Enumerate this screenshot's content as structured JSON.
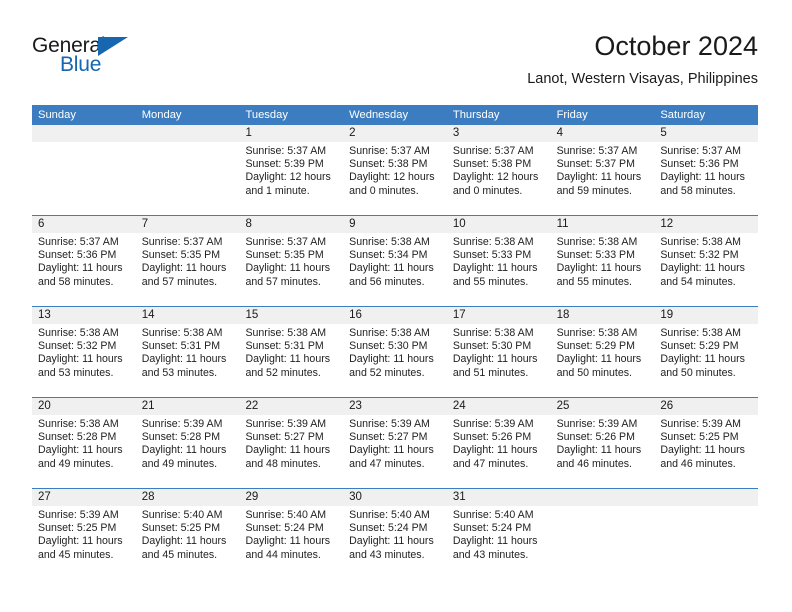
{
  "brand": {
    "name_part1": "General",
    "name_part2": "Blue",
    "triangle_icon": "triangle-icon",
    "accent_color": "#1666b0"
  },
  "header": {
    "title": "October 2024",
    "subtitle": "Lanot, Western Visayas, Philippines"
  },
  "colors": {
    "header_blue": "#3b7dc0",
    "date_band": "#f0f0f0",
    "text": "#1a1a1a"
  },
  "weekdays": [
    "Sunday",
    "Monday",
    "Tuesday",
    "Wednesday",
    "Thursday",
    "Friday",
    "Saturday"
  ],
  "weeks": [
    {
      "days": [
        {
          "num": "",
          "lines": []
        },
        {
          "num": "",
          "lines": []
        },
        {
          "num": "1",
          "lines": [
            "Sunrise: 5:37 AM",
            "Sunset: 5:39 PM",
            "Daylight: 12 hours",
            "and 1 minute."
          ]
        },
        {
          "num": "2",
          "lines": [
            "Sunrise: 5:37 AM",
            "Sunset: 5:38 PM",
            "Daylight: 12 hours",
            "and 0 minutes."
          ]
        },
        {
          "num": "3",
          "lines": [
            "Sunrise: 5:37 AM",
            "Sunset: 5:38 PM",
            "Daylight: 12 hours",
            "and 0 minutes."
          ]
        },
        {
          "num": "4",
          "lines": [
            "Sunrise: 5:37 AM",
            "Sunset: 5:37 PM",
            "Daylight: 11 hours",
            "and 59 minutes."
          ]
        },
        {
          "num": "5",
          "lines": [
            "Sunrise: 5:37 AM",
            "Sunset: 5:36 PM",
            "Daylight: 11 hours",
            "and 58 minutes."
          ]
        }
      ]
    },
    {
      "days": [
        {
          "num": "6",
          "lines": [
            "Sunrise: 5:37 AM",
            "Sunset: 5:36 PM",
            "Daylight: 11 hours",
            "and 58 minutes."
          ]
        },
        {
          "num": "7",
          "lines": [
            "Sunrise: 5:37 AM",
            "Sunset: 5:35 PM",
            "Daylight: 11 hours",
            "and 57 minutes."
          ]
        },
        {
          "num": "8",
          "lines": [
            "Sunrise: 5:37 AM",
            "Sunset: 5:35 PM",
            "Daylight: 11 hours",
            "and 57 minutes."
          ]
        },
        {
          "num": "9",
          "lines": [
            "Sunrise: 5:38 AM",
            "Sunset: 5:34 PM",
            "Daylight: 11 hours",
            "and 56 minutes."
          ]
        },
        {
          "num": "10",
          "lines": [
            "Sunrise: 5:38 AM",
            "Sunset: 5:33 PM",
            "Daylight: 11 hours",
            "and 55 minutes."
          ]
        },
        {
          "num": "11",
          "lines": [
            "Sunrise: 5:38 AM",
            "Sunset: 5:33 PM",
            "Daylight: 11 hours",
            "and 55 minutes."
          ]
        },
        {
          "num": "12",
          "lines": [
            "Sunrise: 5:38 AM",
            "Sunset: 5:32 PM",
            "Daylight: 11 hours",
            "and 54 minutes."
          ]
        }
      ]
    },
    {
      "days": [
        {
          "num": "13",
          "lines": [
            "Sunrise: 5:38 AM",
            "Sunset: 5:32 PM",
            "Daylight: 11 hours",
            "and 53 minutes."
          ]
        },
        {
          "num": "14",
          "lines": [
            "Sunrise: 5:38 AM",
            "Sunset: 5:31 PM",
            "Daylight: 11 hours",
            "and 53 minutes."
          ]
        },
        {
          "num": "15",
          "lines": [
            "Sunrise: 5:38 AM",
            "Sunset: 5:31 PM",
            "Daylight: 11 hours",
            "and 52 minutes."
          ]
        },
        {
          "num": "16",
          "lines": [
            "Sunrise: 5:38 AM",
            "Sunset: 5:30 PM",
            "Daylight: 11 hours",
            "and 52 minutes."
          ]
        },
        {
          "num": "17",
          "lines": [
            "Sunrise: 5:38 AM",
            "Sunset: 5:30 PM",
            "Daylight: 11 hours",
            "and 51 minutes."
          ]
        },
        {
          "num": "18",
          "lines": [
            "Sunrise: 5:38 AM",
            "Sunset: 5:29 PM",
            "Daylight: 11 hours",
            "and 50 minutes."
          ]
        },
        {
          "num": "19",
          "lines": [
            "Sunrise: 5:38 AM",
            "Sunset: 5:29 PM",
            "Daylight: 11 hours",
            "and 50 minutes."
          ]
        }
      ]
    },
    {
      "days": [
        {
          "num": "20",
          "lines": [
            "Sunrise: 5:38 AM",
            "Sunset: 5:28 PM",
            "Daylight: 11 hours",
            "and 49 minutes."
          ]
        },
        {
          "num": "21",
          "lines": [
            "Sunrise: 5:39 AM",
            "Sunset: 5:28 PM",
            "Daylight: 11 hours",
            "and 49 minutes."
          ]
        },
        {
          "num": "22",
          "lines": [
            "Sunrise: 5:39 AM",
            "Sunset: 5:27 PM",
            "Daylight: 11 hours",
            "and 48 minutes."
          ]
        },
        {
          "num": "23",
          "lines": [
            "Sunrise: 5:39 AM",
            "Sunset: 5:27 PM",
            "Daylight: 11 hours",
            "and 47 minutes."
          ]
        },
        {
          "num": "24",
          "lines": [
            "Sunrise: 5:39 AM",
            "Sunset: 5:26 PM",
            "Daylight: 11 hours",
            "and 47 minutes."
          ]
        },
        {
          "num": "25",
          "lines": [
            "Sunrise: 5:39 AM",
            "Sunset: 5:26 PM",
            "Daylight: 11 hours",
            "and 46 minutes."
          ]
        },
        {
          "num": "26",
          "lines": [
            "Sunrise: 5:39 AM",
            "Sunset: 5:25 PM",
            "Daylight: 11 hours",
            "and 46 minutes."
          ]
        }
      ]
    },
    {
      "days": [
        {
          "num": "27",
          "lines": [
            "Sunrise: 5:39 AM",
            "Sunset: 5:25 PM",
            "Daylight: 11 hours",
            "and 45 minutes."
          ]
        },
        {
          "num": "28",
          "lines": [
            "Sunrise: 5:40 AM",
            "Sunset: 5:25 PM",
            "Daylight: 11 hours",
            "and 45 minutes."
          ]
        },
        {
          "num": "29",
          "lines": [
            "Sunrise: 5:40 AM",
            "Sunset: 5:24 PM",
            "Daylight: 11 hours",
            "and 44 minutes."
          ]
        },
        {
          "num": "30",
          "lines": [
            "Sunrise: 5:40 AM",
            "Sunset: 5:24 PM",
            "Daylight: 11 hours",
            "and 43 minutes."
          ]
        },
        {
          "num": "31",
          "lines": [
            "Sunrise: 5:40 AM",
            "Sunset: 5:24 PM",
            "Daylight: 11 hours",
            "and 43 minutes."
          ]
        },
        {
          "num": "",
          "lines": []
        },
        {
          "num": "",
          "lines": []
        }
      ]
    }
  ]
}
